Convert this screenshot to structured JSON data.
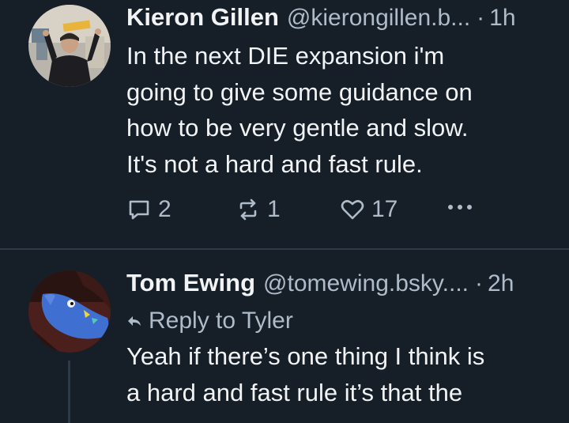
{
  "posts": [
    {
      "author_name": "Kieron Gillen",
      "handle": "@kierongillen.b...",
      "separator": "·",
      "time": "1h",
      "text_lines": [
        "In the next DIE expansion i'm",
        "going to give some guidance on",
        "how to be very gentle and slow.",
        "It's not a hard and fast rule."
      ],
      "actions": {
        "reply_count": "2",
        "repost_count": "1",
        "like_count": "17"
      },
      "avatar_icon": "person-photo-avatar"
    },
    {
      "author_name": "Tom Ewing",
      "handle": "@tomewing.bsky....",
      "separator": "·",
      "time": "2h",
      "reply_to": "Reply to Tyler",
      "text_lines": [
        "Yeah if there’s one thing I think is",
        "a hard and fast rule it’s that the"
      ],
      "avatar_icon": "sock-puppet-avatar"
    }
  ],
  "colors": {
    "background": "#161e27",
    "text": "#f1f3f5",
    "muted": "#aebbc9",
    "divider": "#2e3a48"
  },
  "icons": {
    "reply": "speech-bubble-icon",
    "repost": "repost-arrows-icon",
    "like": "heart-icon",
    "more": "more-dots-icon",
    "reply_to": "reply-arrow-icon"
  }
}
